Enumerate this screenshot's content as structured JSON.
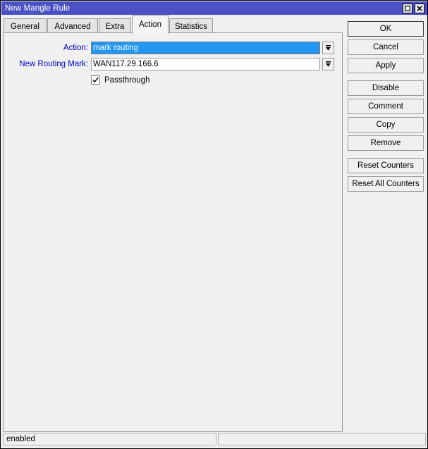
{
  "window": {
    "title": "New Mangle Rule",
    "controls": [
      {
        "name": "maximize-button",
        "icon": "maximize-icon"
      },
      {
        "name": "close-button",
        "icon": "close-icon"
      }
    ]
  },
  "tabs": [
    {
      "label": "General",
      "active": false
    },
    {
      "label": "Advanced",
      "active": false
    },
    {
      "label": "Extra",
      "active": false
    },
    {
      "label": "Action",
      "active": true
    },
    {
      "label": "Statistics",
      "active": false
    }
  ],
  "form": {
    "action": {
      "label": "Action:",
      "value": "mark routing",
      "selected": true,
      "dropdown_icon": "dropdown-arrow-icon"
    },
    "new_routing_mark": {
      "label": "New Routing Mark:",
      "value": "WAN117.29.166.6",
      "selected": false,
      "dropdown_icon": "dropdown-arrow-icon"
    },
    "passthrough": {
      "label": "Passthrough",
      "checked": true
    }
  },
  "buttons": [
    {
      "label": "OK",
      "default": true
    },
    {
      "label": "Cancel",
      "default": false
    },
    {
      "label": "Apply",
      "default": false
    },
    {
      "label": "Disable",
      "default": false,
      "gap_before": true
    },
    {
      "label": "Comment",
      "default": false
    },
    {
      "label": "Copy",
      "default": false
    },
    {
      "label": "Remove",
      "default": false
    },
    {
      "label": "Reset Counters",
      "default": false,
      "gap_before": true
    },
    {
      "label": "Reset All Counters",
      "default": false
    }
  ],
  "statusbar": {
    "left": "enabled",
    "right": ""
  },
  "colors": {
    "titlebar": "#4b51c4",
    "label_text": "#0000c8",
    "selection": "#2196f3",
    "window_bg": "#f0f0f0"
  }
}
